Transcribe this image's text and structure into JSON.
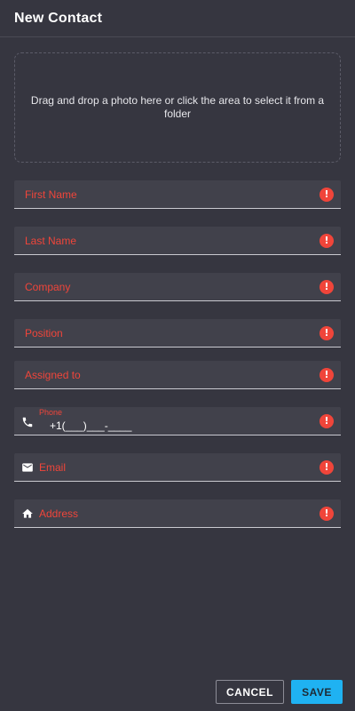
{
  "dialog": {
    "title": "New Contact"
  },
  "photo": {
    "hint": "Drag and drop a photo here or click the area to select it from a folder"
  },
  "fields": {
    "first_name": "First Name",
    "last_name": "Last Name",
    "company": "Company",
    "position": "Position",
    "assigned_to": "Assigned to",
    "phone_label": "Phone",
    "phone_value": "+1(___)___-____",
    "email": "Email",
    "address": "Address"
  },
  "error_symbol": "!",
  "colors": {
    "background": "#363640",
    "field_bg": "#41414b",
    "error": "#f0453a",
    "accent": "#1fb2f2"
  },
  "icons": {
    "phone": "phone-icon",
    "email": "email-icon",
    "address": "home-icon",
    "error": "error-icon"
  },
  "actions": {
    "cancel": "CANCEL",
    "save": "SAVE"
  }
}
